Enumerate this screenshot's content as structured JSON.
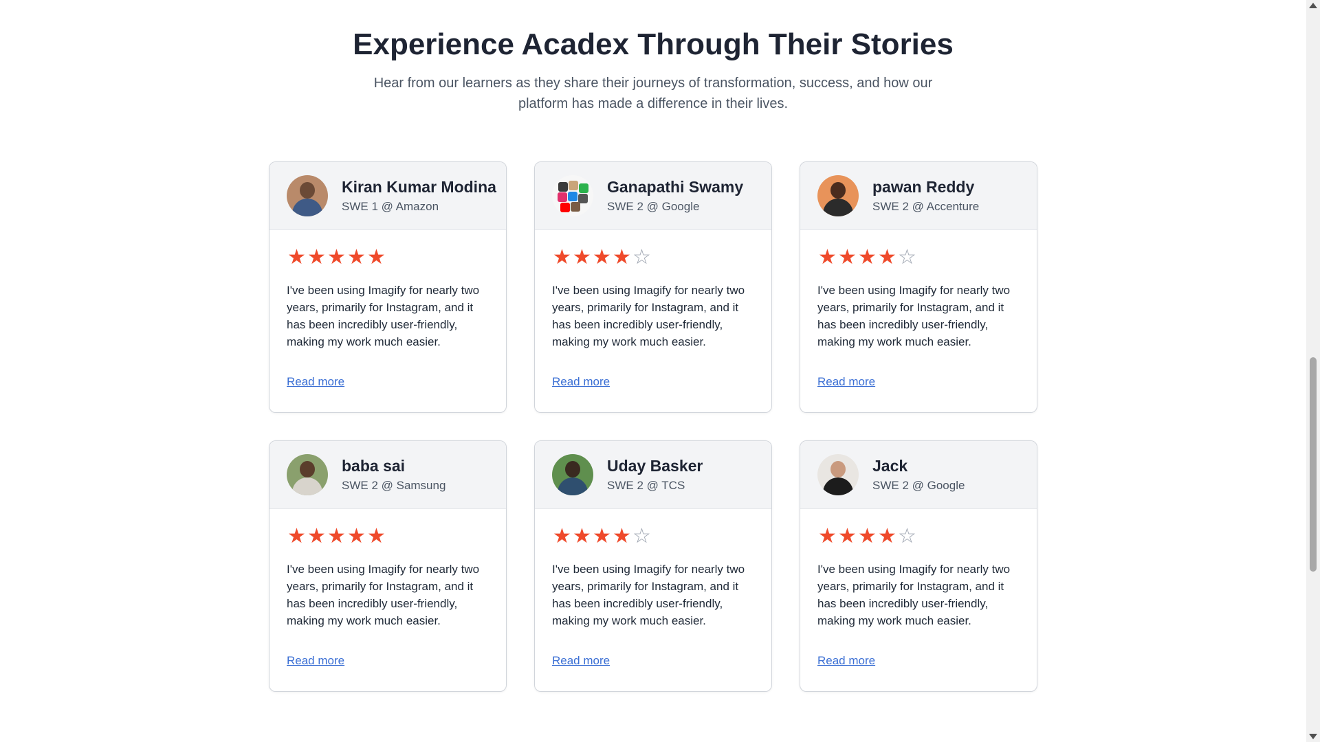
{
  "section": {
    "title": "Experience Acadex Through Their Stories",
    "subtitle": "Hear from our learners as they share their journeys of transformation, success, and how our platform has made a difference in their lives."
  },
  "colors": {
    "star_filled": "#ef4a2b",
    "star_empty": "#9ca3af",
    "link": "#3b6fd4",
    "card_header_bg": "#f3f4f6"
  },
  "testimonials": [
    {
      "name": "Kiran Kumar Modina",
      "role": "SWE 1 @ Amazon",
      "rating": 5,
      "max_rating": 5,
      "quote": "I've been using Imagify for nearly two years, primarily for Instagram, and it has been incredibly user-friendly, making my work much easier.",
      "link_label": "Read more",
      "avatar_icon": "user-photo-icon"
    },
    {
      "name": "Ganapathi Swamy",
      "role": "SWE 2 @ Google",
      "rating": 4,
      "max_rating": 5,
      "quote": "I've been using Imagify for nearly two years, primarily for Instagram, and it has been incredibly user-friendly, making my work much easier.",
      "link_label": "Read more",
      "avatar_icon": "app-collage-icon"
    },
    {
      "name": "pawan Reddy",
      "role": "SWE 2 @ Accenture",
      "rating": 4,
      "max_rating": 5,
      "quote": "I've been using Imagify for nearly two years, primarily for Instagram, and it has been incredibly user-friendly, making my work much easier.",
      "link_label": "Read more",
      "avatar_icon": "user-photo-icon"
    },
    {
      "name": "baba sai",
      "role": "SWE 2 @ Samsung",
      "rating": 5,
      "max_rating": 5,
      "quote": "I've been using Imagify for nearly two years, primarily for Instagram, and it has been incredibly user-friendly, making my work much easier.",
      "link_label": "Read more",
      "avatar_icon": "user-photo-icon"
    },
    {
      "name": "Uday Basker",
      "role": "SWE 2 @ TCS",
      "rating": 4,
      "max_rating": 5,
      "quote": "I've been using Imagify for nearly two years, primarily for Instagram, and it has been incredibly user-friendly, making my work much easier.",
      "link_label": "Read more",
      "avatar_icon": "user-photo-icon"
    },
    {
      "name": "Jack",
      "role": "SWE 2 @ Google",
      "rating": 4,
      "max_rating": 5,
      "quote": "I've been using Imagify for nearly two years, primarily for Instagram, and it has been incredibly user-friendly, making my work much easier.",
      "link_label": "Read more",
      "avatar_icon": "user-photo-icon"
    }
  ]
}
